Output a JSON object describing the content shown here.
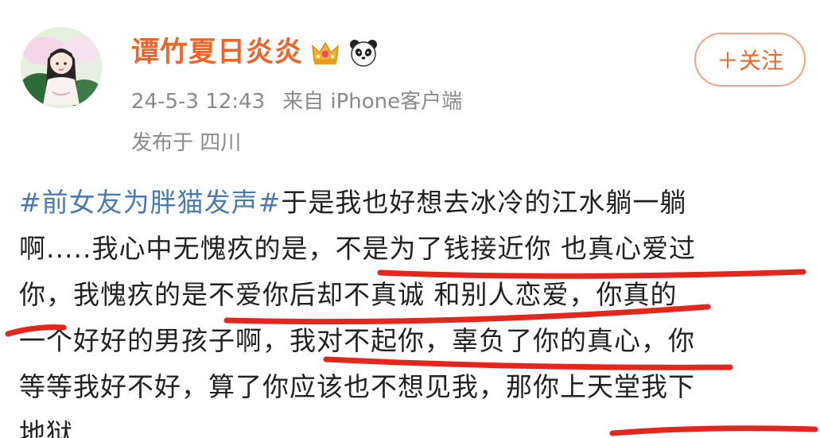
{
  "user": {
    "name": "谭竹夏日炎炎",
    "badge_icons": [
      "crown-badge-icon",
      "panda-badge-icon"
    ]
  },
  "follow": {
    "label": "＋关注"
  },
  "meta": {
    "time": "24-5-3 12:43",
    "source": "来自 iPhone客户端",
    "location": "发布于 四川"
  },
  "post": {
    "hashtag": "#前女友为胖猫发声#",
    "lines": [
      "于是我也好想去冰冷的江水躺一躺",
      "啊.....我心中无愧疚的是，不是为了钱接近你 也真心爱过",
      "你，我愧疚的是不爱你后却不真诚 和别人恋爱，你真的",
      "一个好好的男孩子啊，我对不起你，辜负了你的真心，你",
      "等等我好不好，算了你应该也不想见我，那你上天堂我下",
      "地狱"
    ]
  },
  "colors": {
    "username": "#e9662c",
    "hashtag": "#4b79b2",
    "underline": "#e3271f",
    "meta": "#8a8a8a"
  }
}
